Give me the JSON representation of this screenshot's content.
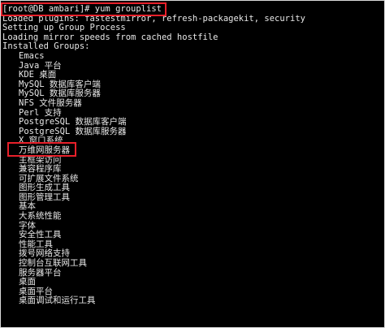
{
  "terminal": {
    "prompt": "[root@DB ambari]# yum grouplist",
    "output": [
      "Loaded plugins: fastestmirror, refresh-packagekit, security",
      "Setting up Group Process",
      "Loading mirror speeds from cached hostfile",
      "Installed Groups:"
    ],
    "installed_groups": [
      "Emacs",
      "Java 平台",
      "KDE 桌面",
      "MySQL 数据库客户端",
      "MySQL 数据库服务器",
      "NFS 文件服务器",
      "Perl 支持",
      "PostgreSQL 数据库客户端",
      "PostgreSQL 数据库服务器",
      "X 窗口系统",
      "万维网服务器",
      "主框架访问",
      "兼容程序库",
      "可扩展文件系统",
      "图形生成工具",
      "图形管理工具",
      "基本",
      "大系统性能",
      "字体",
      "安全性工具",
      "性能工具",
      "拨号网络支持",
      "控制台互联网工具",
      "服务器平台",
      "桌面",
      "桌面平台",
      "桌面调试和运行工具"
    ]
  },
  "colors": {
    "background": "#000000",
    "text": "#e8e8e8",
    "highlight_box": "#e8202a"
  }
}
